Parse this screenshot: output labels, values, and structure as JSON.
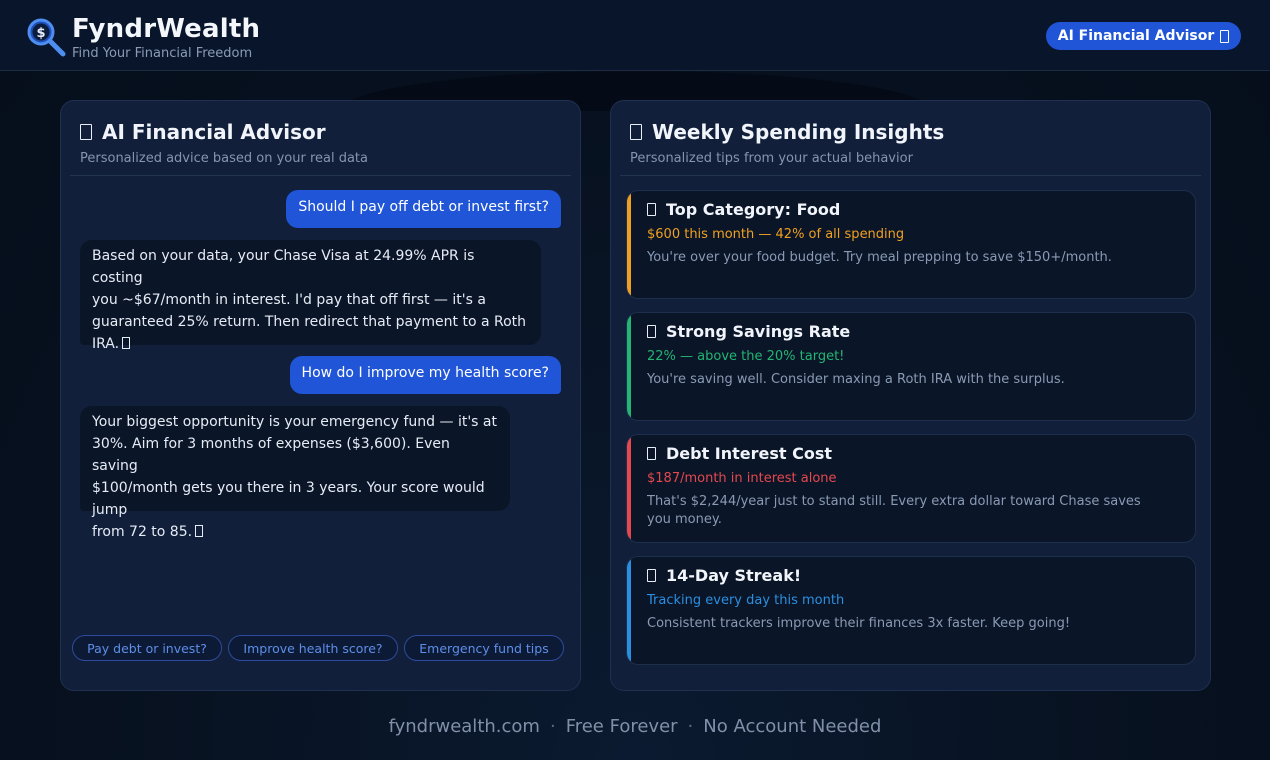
{
  "header": {
    "brand": "FyndrWealth",
    "tagline": "Find Your Financial Freedom",
    "advisor_button": "AI Financial Advisor",
    "logo_icon": "dollar-magnifier-icon"
  },
  "chat": {
    "title": "AI Financial Advisor",
    "subtitle": "Personalized advice based on your real data",
    "messages": [
      {
        "role": "user",
        "text": "Should I pay off debt or invest first?"
      },
      {
        "role": "ai",
        "lines": [
          "Based on your data, your Chase Visa at 24.99% APR is costing",
          "you ~$67/month in interest. I'd pay that off first — it's a",
          "guaranteed 25% return. Then redirect that payment to a Roth",
          "IRA."
        ]
      },
      {
        "role": "user",
        "text": "How do I improve my health score?"
      },
      {
        "role": "ai",
        "lines": [
          "Your biggest opportunity is your emergency fund — it's at",
          "30%. Aim for 3 months of expenses ($3,600). Even saving",
          "$100/month gets you there in 3 years. Your score would jump",
          "from 72 to 85."
        ]
      }
    ],
    "chips": [
      "Pay debt or invest?",
      "Improve health score?",
      "Emergency fund tips"
    ]
  },
  "insights": {
    "title": "Weekly Spending Insights",
    "subtitle": "Personalized tips from your actual behavior",
    "cards": [
      {
        "title": "Top Category: Food",
        "stat": "$600 this month — 42% of all spending",
        "desc": "You're over your food budget. Try meal prepping to save $150+/month.",
        "color": "#f0a020"
      },
      {
        "title": "Strong Savings Rate",
        "stat": "22% — above the 20% target!",
        "desc": "You're saving well. Consider maxing a Roth IRA with the surplus.",
        "color": "#22b573"
      },
      {
        "title": "Debt Interest Cost",
        "stat": "$187/month in interest alone",
        "desc": "That's $2,244/year just to stand still. Every extra dollar toward Chase saves you money.",
        "color": "#e5484d"
      },
      {
        "title": "14-Day Streak!",
        "stat": "Tracking every day this month",
        "desc": "Consistent trackers improve their finances 3x faster. Keep going!",
        "color": "#2b8fe0"
      }
    ]
  },
  "footer": {
    "site": "fyndrwealth.com",
    "free": "Free Forever",
    "no_account": "No Account Needed"
  }
}
